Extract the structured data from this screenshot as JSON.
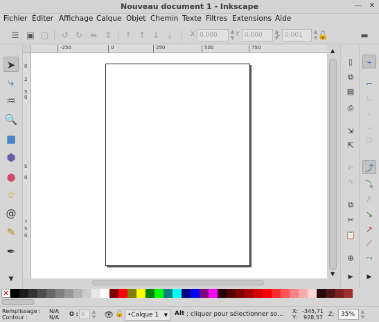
{
  "window": {
    "title": "Nouveau document 1 - Inkscape"
  },
  "menu": [
    "Fichier",
    "Éditer",
    "Affichage",
    "Calque",
    "Objet",
    "Chemin",
    "Texte",
    "Filtres",
    "Extensions",
    "Aide"
  ],
  "controls": {
    "x_label": "X",
    "x_value": "0,000",
    "y_label": "Y",
    "y_value": "0,000",
    "w_label": "L",
    "w_value": "0,001"
  },
  "ruler": {
    "h_labels": [
      "-250",
      "0",
      "250",
      "500",
      "750"
    ],
    "v_labels": [
      "0",
      "2",
      "5",
      "0",
      "5",
      "0",
      "7",
      "5",
      "0"
    ]
  },
  "palette": {
    "colors": [
      "#000000",
      "#1a1a1a",
      "#333333",
      "#4d4d4d",
      "#666666",
      "#808080",
      "#999999",
      "#b3b3b3",
      "#cccccc",
      "#e6e6e6",
      "#ffffff",
      "#800000",
      "#ff0000",
      "#808000",
      "#ffff00",
      "#008000",
      "#00ff00",
      "#008080",
      "#00ffff",
      "#000080",
      "#0000ff",
      "#800080",
      "#ff00ff",
      "#2b0000",
      "#550000",
      "#800000",
      "#aa0000",
      "#d40000",
      "#ff0000",
      "#ff2a2a",
      "#ff5555",
      "#ff8080",
      "#ffaaaa",
      "#ffd5d5",
      "#280b0b",
      "#501616",
      "#782121",
      "#a02c2c"
    ]
  },
  "status": {
    "fill_label": "Remplissage :",
    "fill_value": "N/A",
    "stroke_label": "Contour :",
    "stroke_value": "N/A",
    "opacity_label": "O :",
    "opacity_value": "0",
    "layer": "•Calque 1",
    "message_key": "Alt",
    "message": " : cliquer pour sélectionner so...",
    "x_label": "X:",
    "x_value": "-345,71",
    "y_label": "Y:",
    "y_value": "928,57",
    "z_label": "Z:",
    "zoom": "35%"
  }
}
